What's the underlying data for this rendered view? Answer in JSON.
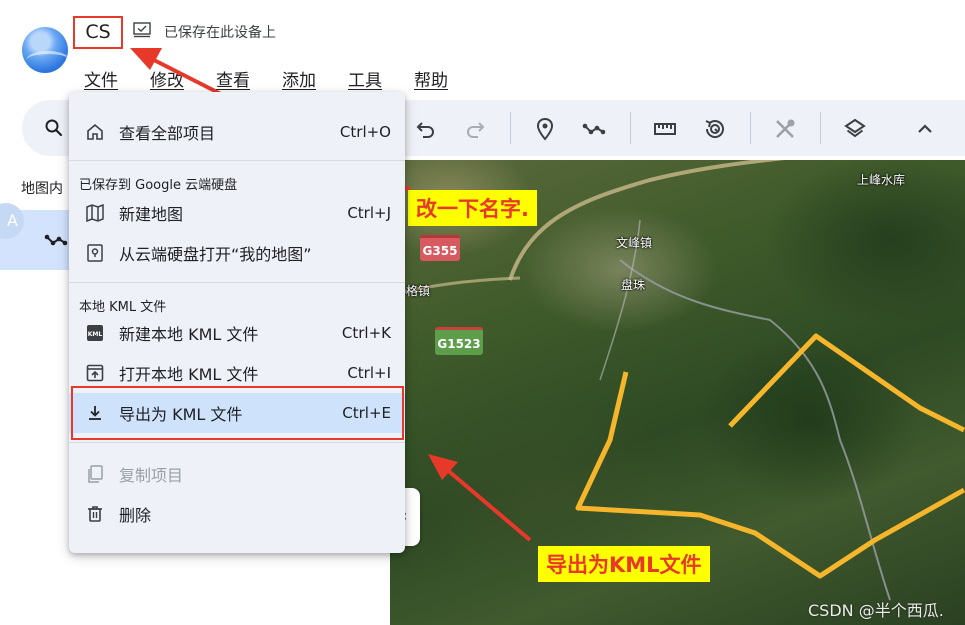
{
  "app": {
    "title": "CS",
    "save_status": "已保存在此设备上"
  },
  "menubar": [
    "文件",
    "修改",
    "查看",
    "添加",
    "工具",
    "帮助"
  ],
  "panel": {
    "label": "地图内",
    "avatar_letter": "A"
  },
  "file_menu": {
    "items": [
      {
        "icon": "home-icon",
        "label": "查看全部项目",
        "shortcut": "Ctrl+O"
      },
      {
        "icon": "map-icon",
        "label": "新建地图",
        "shortcut": "Ctrl+J"
      },
      {
        "icon": "map-pin-icon",
        "label": "从云端硬盘打开“我的地图”",
        "shortcut": ""
      },
      {
        "icon": "kml-icon",
        "label": "新建本地 KML 文件",
        "shortcut": "Ctrl+K"
      },
      {
        "icon": "open-file-icon",
        "label": "打开本地 KML 文件",
        "shortcut": "Ctrl+I"
      },
      {
        "icon": "download-icon",
        "label": "导出为 KML 文件",
        "shortcut": "Ctrl+E"
      },
      {
        "icon": "copy-icon",
        "label": "复制项目",
        "shortcut": ""
      },
      {
        "icon": "trash-icon",
        "label": "删除",
        "shortcut": ""
      }
    ],
    "sections": {
      "drive": "已保存到 Google 云端硬盘",
      "local": "本地 KML 文件"
    }
  },
  "map": {
    "labels": {
      "reservoir": "上峰水库",
      "town1": "文峰镇",
      "town2": "盘珠",
      "town3": "格镇"
    },
    "shields": {
      "g355": "G355",
      "g1523": "G1523"
    },
    "watermark": "CSDN @半个西瓜."
  },
  "annotations": {
    "rename": "改一下名字.",
    "export": "导出为KML文件"
  },
  "colors": {
    "accent": "#e8382a",
    "annotation_bg": "#ffff00",
    "menu_bg": "#eef2f8",
    "selected_bg": "#cfe2fc",
    "route": "#f6b62b"
  }
}
